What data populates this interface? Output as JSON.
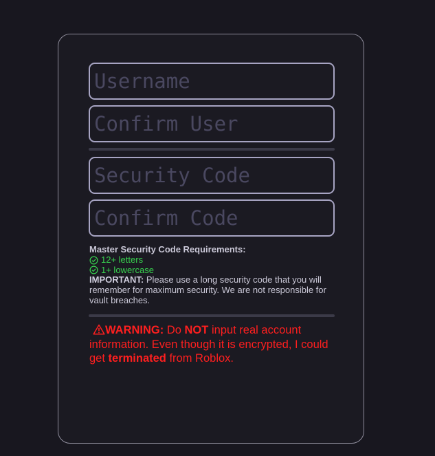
{
  "form": {
    "username_placeholder": "Username",
    "confirm_user_placeholder": "Confirm User",
    "security_code_placeholder": "Security Code",
    "confirm_code_placeholder": "Confirm Code"
  },
  "requirements": {
    "heading": "Master Security Code Requirements:",
    "items": [
      "12+ letters",
      "1+ lowercase"
    ],
    "important_label": "IMPORTANT:",
    "important_text": " Please use a long security code that you will remember for maximum security. We are not responsible for vault breaches."
  },
  "warning": {
    "icon": "warning-triangle-icon",
    "label": "WARNING:",
    "text1": " Do ",
    "not": "NOT",
    "text2": " input real account information. Even though it is encrypted, I could get ",
    "terminated": "terminated",
    "text3": " from Roblox."
  },
  "colors": {
    "background": "#18171f",
    "field_border": "#a7a4c3",
    "success": "#38d24f",
    "warning": "#ff1f1f"
  }
}
